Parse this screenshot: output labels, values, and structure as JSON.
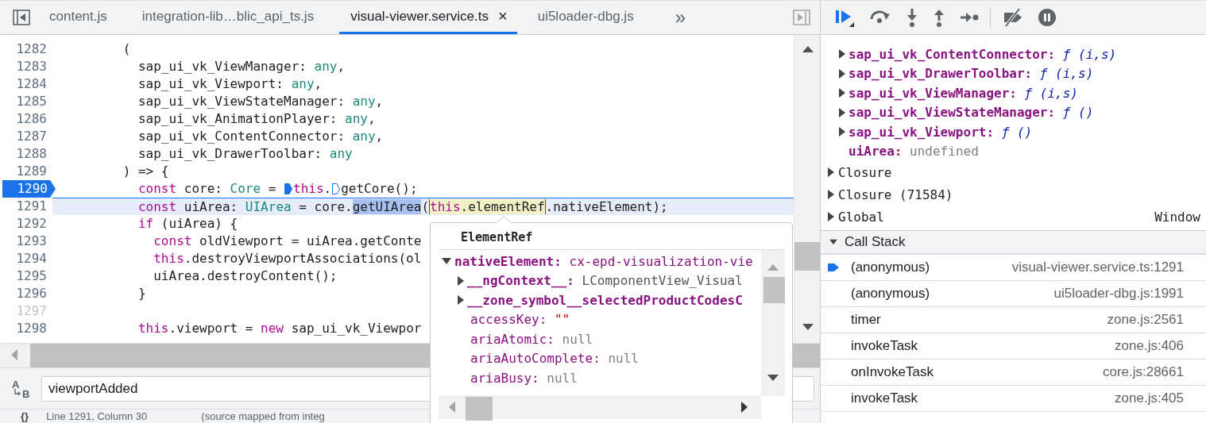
{
  "editor": {
    "tabs": [
      {
        "label": "content.js",
        "selected": false
      },
      {
        "label": "integration-lib…blic_api_ts.js",
        "selected": false
      },
      {
        "label": "visual-viewer.service.ts",
        "selected": true,
        "close_glyph": "×"
      },
      {
        "label": "ui5loader-dbg.js",
        "selected": false
      }
    ],
    "tab_overflow": "»",
    "lines": [
      {
        "number": "1282",
        "breakpoint": false,
        "current": false,
        "inactive": false,
        "tokens": [
          {
            "text": "         (",
            "kind": "plain"
          }
        ]
      },
      {
        "number": "1283",
        "breakpoint": false,
        "current": false,
        "inactive": false,
        "tokens": [
          {
            "text": "           sap_ui_vk_ViewManager: ",
            "kind": "plain"
          },
          {
            "text": "any",
            "kind": "type"
          },
          {
            "text": ",",
            "kind": "plain"
          }
        ]
      },
      {
        "number": "1284",
        "breakpoint": false,
        "current": false,
        "inactive": false,
        "tokens": [
          {
            "text": "           sap_ui_vk_Viewport: ",
            "kind": "plain"
          },
          {
            "text": "any",
            "kind": "type"
          },
          {
            "text": ",",
            "kind": "plain"
          }
        ]
      },
      {
        "number": "1285",
        "breakpoint": false,
        "current": false,
        "inactive": false,
        "tokens": [
          {
            "text": "           sap_ui_vk_ViewStateManager: ",
            "kind": "plain"
          },
          {
            "text": "any",
            "kind": "type"
          },
          {
            "text": ",",
            "kind": "plain"
          }
        ]
      },
      {
        "number": "1286",
        "breakpoint": false,
        "current": false,
        "inactive": false,
        "tokens": [
          {
            "text": "           sap_ui_vk_AnimationPlayer: ",
            "kind": "plain"
          },
          {
            "text": "any",
            "kind": "type"
          },
          {
            "text": ",",
            "kind": "plain"
          }
        ]
      },
      {
        "number": "1287",
        "breakpoint": false,
        "current": false,
        "inactive": false,
        "tokens": [
          {
            "text": "           sap_ui_vk_ContentConnector: ",
            "kind": "plain"
          },
          {
            "text": "any",
            "kind": "type"
          },
          {
            "text": ",",
            "kind": "plain"
          }
        ]
      },
      {
        "number": "1288",
        "breakpoint": false,
        "current": false,
        "inactive": false,
        "tokens": [
          {
            "text": "           sap_ui_vk_DrawerToolbar: ",
            "kind": "plain"
          },
          {
            "text": "any",
            "kind": "type"
          }
        ]
      },
      {
        "number": "1289",
        "breakpoint": false,
        "current": false,
        "inactive": false,
        "tokens": [
          {
            "text": "         ) => {",
            "kind": "plain"
          }
        ]
      },
      {
        "number": "1290",
        "breakpoint": true,
        "current": false,
        "inactive": false,
        "tokens": [
          {
            "text": "           const",
            "kind": "keyword"
          },
          {
            "text": " core: ",
            "kind": "plain"
          },
          {
            "text": "Core",
            "kind": "type"
          },
          {
            "text": " = ",
            "kind": "plain"
          },
          {
            "kind": "marker-solid"
          },
          {
            "text": "this",
            "kind": "keyword"
          },
          {
            "text": ".",
            "kind": "plain"
          },
          {
            "kind": "marker-hollow"
          },
          {
            "text": "getCore();",
            "kind": "plain"
          }
        ]
      },
      {
        "number": "1291",
        "breakpoint": false,
        "current": true,
        "inactive": false,
        "tokens": [
          {
            "text": "           const",
            "kind": "keyword"
          },
          {
            "text": " uiArea: ",
            "kind": "plain"
          },
          {
            "text": "UIArea",
            "kind": "type"
          },
          {
            "text": " = core.",
            "kind": "plain"
          },
          {
            "text": "getUIArea",
            "kind": "selection"
          },
          {
            "text": "(",
            "kind": "plain"
          },
          {
            "text": "this",
            "kind": "hover-keyword"
          },
          {
            "text": ".elementRef",
            "kind": "hover-plain"
          },
          {
            "text": ".nativeElement);",
            "kind": "plain"
          }
        ]
      },
      {
        "number": "1292",
        "breakpoint": false,
        "current": false,
        "inactive": false,
        "tokens": [
          {
            "text": "           if",
            "kind": "keyword"
          },
          {
            "text": " (uiArea) {",
            "kind": "plain"
          }
        ]
      },
      {
        "number": "1293",
        "breakpoint": false,
        "current": false,
        "inactive": false,
        "tokens": [
          {
            "text": "             const",
            "kind": "keyword"
          },
          {
            "text": " oldViewport = uiArea.getConte",
            "kind": "plain"
          }
        ]
      },
      {
        "number": "1294",
        "breakpoint": false,
        "current": false,
        "inactive": false,
        "tokens": [
          {
            "text": "             this",
            "kind": "keyword"
          },
          {
            "text": ".destroyViewportAssociations(ol",
            "kind": "plain"
          }
        ]
      },
      {
        "number": "1295",
        "breakpoint": false,
        "current": false,
        "inactive": false,
        "tokens": [
          {
            "text": "             uiArea.destroyContent();",
            "kind": "plain"
          }
        ]
      },
      {
        "number": "1296",
        "breakpoint": false,
        "current": false,
        "inactive": false,
        "tokens": [
          {
            "text": "           }",
            "kind": "plain"
          }
        ]
      },
      {
        "number": "1297",
        "breakpoint": false,
        "current": false,
        "inactive": true
      },
      {
        "number": "1298",
        "breakpoint": false,
        "current": false,
        "inactive": false,
        "tokens": [
          {
            "text": "           this",
            "kind": "keyword"
          },
          {
            "text": ".viewport = ",
            "kind": "plain"
          },
          {
            "text": "new",
            "kind": "keyword"
          },
          {
            "text": " sap_ui_vk_Viewpor",
            "kind": "plain"
          }
        ]
      }
    ],
    "search": {
      "toggle_glyphs": [
        "A",
        "B"
      ],
      "value": "viewportAdded"
    },
    "status_bar": {
      "format_glyph": "{}",
      "position": "Line 1291, Column 30",
      "source": "(source mapped from integ"
    }
  },
  "popup": {
    "title": "ElementRef",
    "rows": [
      {
        "key": "nativeElement:",
        "value": "cx-epd-visualization-vie",
        "kind": "node",
        "own": true,
        "expanded": true,
        "children": [
          {
            "key": "__ngContext__:",
            "value": "LComponentView_Visual",
            "kind": "object",
            "own": true,
            "expanded": false
          },
          {
            "key": "__zone_symbol__selectedProductCodesC",
            "own": true,
            "expanded": false
          },
          {
            "key": "accessKey:",
            "value": "\"\"",
            "kind": "string",
            "own": false
          },
          {
            "key": "ariaAtomic:",
            "value": "null",
            "kind": "null",
            "own": false
          },
          {
            "key": "ariaAutoComplete:",
            "value": "null",
            "kind": "null",
            "own": false
          },
          {
            "key": "ariaBusy:",
            "value": "null",
            "kind": "null",
            "own": false
          }
        ]
      }
    ]
  },
  "scope": {
    "entries": [
      {
        "name": "sap_ui_vk_ContentConnector:",
        "value": "ƒ (i,s)",
        "kind": "function",
        "expanded": false
      },
      {
        "name": "sap_ui_vk_DrawerToolbar:",
        "value": "ƒ (i,s)",
        "kind": "function",
        "expanded": false
      },
      {
        "name": "sap_ui_vk_ViewManager:",
        "value": "ƒ (i,s)",
        "kind": "function",
        "expanded": false
      },
      {
        "name": "sap_ui_vk_ViewStateManager:",
        "value": "ƒ ()",
        "kind": "function",
        "expanded": false
      },
      {
        "name": "sap_ui_vk_Viewport:",
        "value": "ƒ ()",
        "kind": "function",
        "expanded": false
      },
      {
        "name": "uiArea:",
        "value": "undefined",
        "kind": "undefined"
      }
    ],
    "scopes": [
      {
        "label": "Closure",
        "expanded": false
      },
      {
        "label": "Closure (71584)",
        "expanded": false
      },
      {
        "label": "Global",
        "expanded": false,
        "detail": "Window"
      }
    ]
  },
  "call_stack": {
    "title": "Call Stack",
    "expanded": true,
    "frames": [
      {
        "name": "(anonymous)",
        "location": "visual-viewer.service.ts:1291",
        "selected": true
      },
      {
        "name": "(anonymous)",
        "location": "ui5loader-dbg.js:1991",
        "selected": false
      },
      {
        "name": "timer",
        "location": "zone.js:2561",
        "selected": false
      },
      {
        "name": "invokeTask",
        "location": "zone.js:406",
        "selected": false
      },
      {
        "name": "onInvokeTask",
        "location": "core.js:28661",
        "selected": false
      },
      {
        "name": "invokeTask",
        "location": "zone.js:405",
        "selected": false
      }
    ]
  }
}
